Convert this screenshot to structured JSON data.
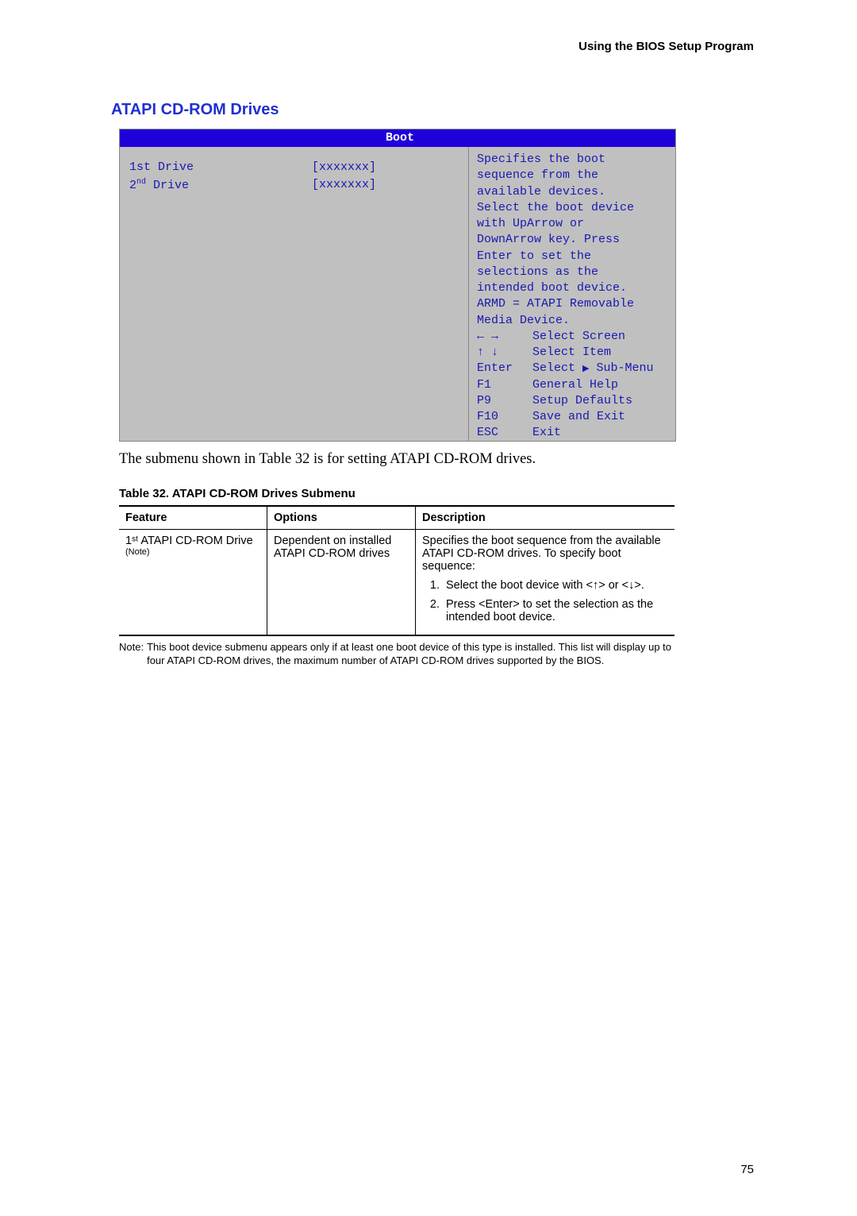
{
  "header": {
    "title": "Using the BIOS Setup Program"
  },
  "section": {
    "title": "ATAPI CD-ROM Drives"
  },
  "bios": {
    "tab_label": "Boot",
    "drives": [
      {
        "label_prefix": "1st",
        "label_word": "Drive",
        "value": "[xxxxxxx]"
      },
      {
        "label_prefix_html": "2",
        "label_sup": "nd",
        "label_word": "Drive",
        "value": "[xxxxxxx]"
      }
    ],
    "help": [
      "Specifies the boot",
      "sequence from the",
      "available devices.",
      "Select the boot device",
      "with UpArrow or",
      "DownArrow key.  Press",
      "Enter to set the",
      "selections as the",
      "intended boot device.",
      "ARMD = ATAPI Removable",
      "Media Device."
    ],
    "nav": [
      {
        "key": "← →",
        "desc": "Select Screen"
      },
      {
        "key": "↑ ↓",
        "desc": "Select Item"
      },
      {
        "key": "Enter",
        "desc_prefix": "Select ",
        "desc_icon": "▶",
        "desc_suffix": " Sub-Menu"
      },
      {
        "key": "F1",
        "desc": "General Help"
      },
      {
        "key": "P9",
        "desc": "Setup Defaults"
      },
      {
        "key": "F10",
        "desc": "Save and Exit"
      },
      {
        "key": "ESC",
        "desc": "Exit"
      }
    ]
  },
  "caption": "The submenu shown in Table 32 is for setting ATAPI CD-ROM drives.",
  "table": {
    "caption": "Table 32.   ATAPI CD-ROM Drives Submenu",
    "headers": {
      "c1": "Feature",
      "c2": "Options",
      "c3": "Description"
    },
    "row": {
      "feature_main": "1ˢᵗ ATAPI CD-ROM Drive",
      "feature_note": "(Note)",
      "options": "Dependent on installed ATAPI CD-ROM drives",
      "desc_intro": "Specifies the boot sequence from the available ATAPI CD-ROM drives.  To specify boot sequence:",
      "desc_steps": [
        "Select the boot device with <↑> or <↓>.",
        "Press <Enter> to set the selection as the intended boot device."
      ]
    }
  },
  "note": {
    "label": "Note:",
    "body": "This boot device submenu appears only if at least one boot device of this type is installed.  This list will display up to four ATAPI CD-ROM drives, the maximum number of ATAPI CD-ROM drives supported by the BIOS."
  },
  "page_number": "75"
}
